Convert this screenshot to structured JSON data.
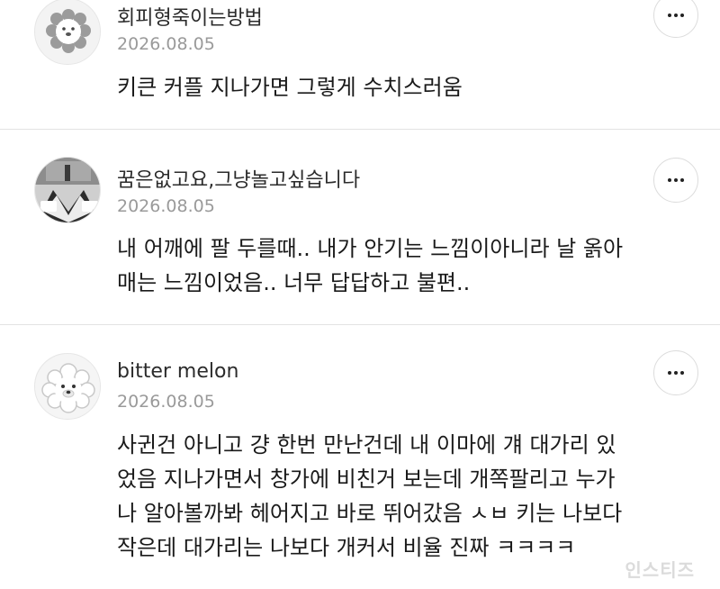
{
  "comments": [
    {
      "username": "회피형죽이는방법",
      "date": "2026.08.05",
      "text": "키큰 커플 지나가면 그렇게 수치스러움",
      "avatar_icon": "lion-face-icon"
    },
    {
      "username": "꿈은없고요,그냥놀고싶습니다",
      "date": "2026.08.05",
      "text": "내 어깨에 팔 두를때.. 내가 안기는 느낌이아니라 날 옭아\n매는 느낌이었음.. 너무 답답하고 불편..",
      "avatar_icon": "meme-photo-avatar"
    },
    {
      "username": "bitter melon",
      "date": "2026.08.05",
      "text": "사귄건 아니고 걍 한번 만난건데 내 이마에 걔 대가리 있\n었음 지나가면서 창가에 비친거 보는데 개쪽팔리고 누가\n나 알아볼까봐 헤어지고 바로 뛰어갔음 ㅅㅂ 키는 나보다\n작은데 대가리는 나보다 개커서 비율 진짜 ㅋㅋㅋㅋ",
      "avatar_icon": "poodle-face-icon"
    }
  ],
  "watermark": "인스티즈",
  "colors": {
    "divider": "#e3e3e3",
    "date": "#9a9a9a",
    "text": "#1a1a1a"
  }
}
